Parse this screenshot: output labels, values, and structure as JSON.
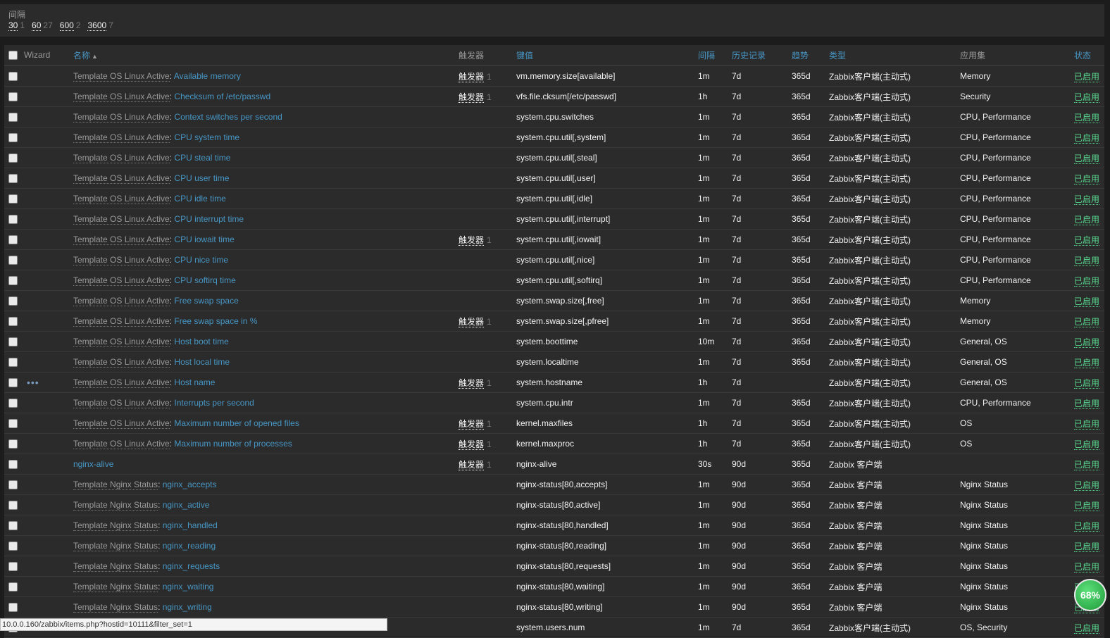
{
  "filter": {
    "title": "间隔",
    "values": [
      {
        "value": "30",
        "count": "1"
      },
      {
        "value": "60",
        "count": "27"
      },
      {
        "value": "600",
        "count": "2"
      },
      {
        "value": "3600",
        "count": "7"
      }
    ]
  },
  "table": {
    "headers": {
      "wizard": "Wizard",
      "name": "名称",
      "triggers": "触发器",
      "key": "键值",
      "interval": "间隔",
      "history": "历史记录",
      "trends": "趋势",
      "type": "类型",
      "applications": "应用集",
      "status": "状态"
    },
    "rows": [
      {
        "template": "Template OS Linux Active",
        "name": "Available memory",
        "trigger": "触发器",
        "trigger_count": "1",
        "key": "vm.memory.size[available]",
        "interval": "1m",
        "history": "7d",
        "trends": "365d",
        "type": "Zabbix客户端(主动式)",
        "apps": "Memory",
        "status": "已启用"
      },
      {
        "template": "Template OS Linux Active",
        "name": "Checksum of /etc/passwd",
        "trigger": "触发器",
        "trigger_count": "1",
        "key": "vfs.file.cksum[/etc/passwd]",
        "interval": "1h",
        "history": "7d",
        "trends": "365d",
        "type": "Zabbix客户端(主动式)",
        "apps": "Security",
        "status": "已启用"
      },
      {
        "template": "Template OS Linux Active",
        "name": "Context switches per second",
        "trigger": "",
        "trigger_count": "",
        "key": "system.cpu.switches",
        "interval": "1m",
        "history": "7d",
        "trends": "365d",
        "type": "Zabbix客户端(主动式)",
        "apps": "CPU, Performance",
        "status": "已启用"
      },
      {
        "template": "Template OS Linux Active",
        "name": "CPU system time",
        "trigger": "",
        "trigger_count": "",
        "key": "system.cpu.util[,system]",
        "interval": "1m",
        "history": "7d",
        "trends": "365d",
        "type": "Zabbix客户端(主动式)",
        "apps": "CPU, Performance",
        "status": "已启用"
      },
      {
        "template": "Template OS Linux Active",
        "name": "CPU steal time",
        "trigger": "",
        "trigger_count": "",
        "key": "system.cpu.util[,steal]",
        "interval": "1m",
        "history": "7d",
        "trends": "365d",
        "type": "Zabbix客户端(主动式)",
        "apps": "CPU, Performance",
        "status": "已启用"
      },
      {
        "template": "Template OS Linux Active",
        "name": "CPU user time",
        "trigger": "",
        "trigger_count": "",
        "key": "system.cpu.util[,user]",
        "interval": "1m",
        "history": "7d",
        "trends": "365d",
        "type": "Zabbix客户端(主动式)",
        "apps": "CPU, Performance",
        "status": "已启用"
      },
      {
        "template": "Template OS Linux Active",
        "name": "CPU idle time",
        "trigger": "",
        "trigger_count": "",
        "key": "system.cpu.util[,idle]",
        "interval": "1m",
        "history": "7d",
        "trends": "365d",
        "type": "Zabbix客户端(主动式)",
        "apps": "CPU, Performance",
        "status": "已启用"
      },
      {
        "template": "Template OS Linux Active",
        "name": "CPU interrupt time",
        "trigger": "",
        "trigger_count": "",
        "key": "system.cpu.util[,interrupt]",
        "interval": "1m",
        "history": "7d",
        "trends": "365d",
        "type": "Zabbix客户端(主动式)",
        "apps": "CPU, Performance",
        "status": "已启用"
      },
      {
        "template": "Template OS Linux Active",
        "name": "CPU iowait time",
        "trigger": "触发器",
        "trigger_count": "1",
        "key": "system.cpu.util[,iowait]",
        "interval": "1m",
        "history": "7d",
        "trends": "365d",
        "type": "Zabbix客户端(主动式)",
        "apps": "CPU, Performance",
        "status": "已启用"
      },
      {
        "template": "Template OS Linux Active",
        "name": "CPU nice time",
        "trigger": "",
        "trigger_count": "",
        "key": "system.cpu.util[,nice]",
        "interval": "1m",
        "history": "7d",
        "trends": "365d",
        "type": "Zabbix客户端(主动式)",
        "apps": "CPU, Performance",
        "status": "已启用"
      },
      {
        "template": "Template OS Linux Active",
        "name": "CPU softirq time",
        "trigger": "",
        "trigger_count": "",
        "key": "system.cpu.util[,softirq]",
        "interval": "1m",
        "history": "7d",
        "trends": "365d",
        "type": "Zabbix客户端(主动式)",
        "apps": "CPU, Performance",
        "status": "已启用"
      },
      {
        "template": "Template OS Linux Active",
        "name": "Free swap space",
        "trigger": "",
        "trigger_count": "",
        "key": "system.swap.size[,free]",
        "interval": "1m",
        "history": "7d",
        "trends": "365d",
        "type": "Zabbix客户端(主动式)",
        "apps": "Memory",
        "status": "已启用"
      },
      {
        "template": "Template OS Linux Active",
        "name": "Free swap space in %",
        "trigger": "触发器",
        "trigger_count": "1",
        "key": "system.swap.size[,pfree]",
        "interval": "1m",
        "history": "7d",
        "trends": "365d",
        "type": "Zabbix客户端(主动式)",
        "apps": "Memory",
        "status": "已启用"
      },
      {
        "template": "Template OS Linux Active",
        "name": "Host boot time",
        "trigger": "",
        "trigger_count": "",
        "key": "system.boottime",
        "interval": "10m",
        "history": "7d",
        "trends": "365d",
        "type": "Zabbix客户端(主动式)",
        "apps": "General, OS",
        "status": "已启用"
      },
      {
        "template": "Template OS Linux Active",
        "name": "Host local time",
        "trigger": "",
        "trigger_count": "",
        "key": "system.localtime",
        "interval": "1m",
        "history": "7d",
        "trends": "365d",
        "type": "Zabbix客户端(主动式)",
        "apps": "General, OS",
        "status": "已启用"
      },
      {
        "template": "Template OS Linux Active",
        "name": "Host name",
        "trigger": "触发器",
        "trigger_count": "1",
        "key": "system.hostname",
        "interval": "1h",
        "history": "7d",
        "trends": "",
        "type": "Zabbix客户端(主动式)",
        "apps": "General, OS",
        "status": "已启用",
        "wizard": "•••"
      },
      {
        "template": "Template OS Linux Active",
        "name": "Interrupts per second",
        "trigger": "",
        "trigger_count": "",
        "key": "system.cpu.intr",
        "interval": "1m",
        "history": "7d",
        "trends": "365d",
        "type": "Zabbix客户端(主动式)",
        "apps": "CPU, Performance",
        "status": "已启用"
      },
      {
        "template": "Template OS Linux Active",
        "name": "Maximum number of opened files",
        "trigger": "触发器",
        "trigger_count": "1",
        "key": "kernel.maxfiles",
        "interval": "1h",
        "history": "7d",
        "trends": "365d",
        "type": "Zabbix客户端(主动式)",
        "apps": "OS",
        "status": "已启用"
      },
      {
        "template": "Template OS Linux Active",
        "name": "Maximum number of processes",
        "trigger": "触发器",
        "trigger_count": "1",
        "key": "kernel.maxproc",
        "interval": "1h",
        "history": "7d",
        "trends": "365d",
        "type": "Zabbix客户端(主动式)",
        "apps": "OS",
        "status": "已启用"
      },
      {
        "template": "",
        "name": "nginx-alive",
        "trigger": "触发器",
        "trigger_count": "1",
        "key": "nginx-alive",
        "interval": "30s",
        "history": "90d",
        "trends": "365d",
        "type": "Zabbix 客户端",
        "apps": "",
        "status": "已启用"
      },
      {
        "template": "Template Nginx Status",
        "name": "nginx_accepts",
        "trigger": "",
        "trigger_count": "",
        "key": "nginx-status[80,accepts]",
        "interval": "1m",
        "history": "90d",
        "trends": "365d",
        "type": "Zabbix 客户端",
        "apps": "Nginx Status",
        "status": "已启用"
      },
      {
        "template": "Template Nginx Status",
        "name": "nginx_active",
        "trigger": "",
        "trigger_count": "",
        "key": "nginx-status[80,active]",
        "interval": "1m",
        "history": "90d",
        "trends": "365d",
        "type": "Zabbix 客户端",
        "apps": "Nginx Status",
        "status": "已启用"
      },
      {
        "template": "Template Nginx Status",
        "name": "nginx_handled",
        "trigger": "",
        "trigger_count": "",
        "key": "nginx-status[80,handled]",
        "interval": "1m",
        "history": "90d",
        "trends": "365d",
        "type": "Zabbix 客户端",
        "apps": "Nginx Status",
        "status": "已启用"
      },
      {
        "template": "Template Nginx Status",
        "name": "nginx_reading",
        "trigger": "",
        "trigger_count": "",
        "key": "nginx-status[80,reading]",
        "interval": "1m",
        "history": "90d",
        "trends": "365d",
        "type": "Zabbix 客户端",
        "apps": "Nginx Status",
        "status": "已启用"
      },
      {
        "template": "Template Nginx Status",
        "name": "nginx_requests",
        "trigger": "",
        "trigger_count": "",
        "key": "nginx-status[80,requests]",
        "interval": "1m",
        "history": "90d",
        "trends": "365d",
        "type": "Zabbix 客户端",
        "apps": "Nginx Status",
        "status": "已启用"
      },
      {
        "template": "Template Nginx Status",
        "name": "nginx_waiting",
        "trigger": "",
        "trigger_count": "",
        "key": "nginx-status[80,waiting]",
        "interval": "1m",
        "history": "90d",
        "trends": "365d",
        "type": "Zabbix 客户端",
        "apps": "Nginx Status",
        "status": "已启用"
      },
      {
        "template": "Template Nginx Status",
        "name": "nginx_writing",
        "trigger": "",
        "trigger_count": "",
        "key": "nginx-status[80,writing]",
        "interval": "1m",
        "history": "90d",
        "trends": "365d",
        "type": "Zabbix 客户端",
        "apps": "Nginx Status",
        "status": "已启用"
      },
      {
        "template": "",
        "name": "",
        "trigger": "",
        "trigger_count": "",
        "key": "system.users.num",
        "interval": "1m",
        "history": "7d",
        "trends": "365d",
        "type": "Zabbix客户端(主动式)",
        "apps": "OS, Security",
        "status": "已启用"
      }
    ]
  },
  "browser_status": {
    "url": "10.0.0.160/zabbix/items.php?hostid=10111&filter_set=1"
  },
  "progress_badge": {
    "label": "68%",
    "value": 68
  },
  "colors": {
    "link": "#4796c4",
    "enabled": "#59db8f",
    "muted": "#999999",
    "background": "#2b2b2b"
  }
}
